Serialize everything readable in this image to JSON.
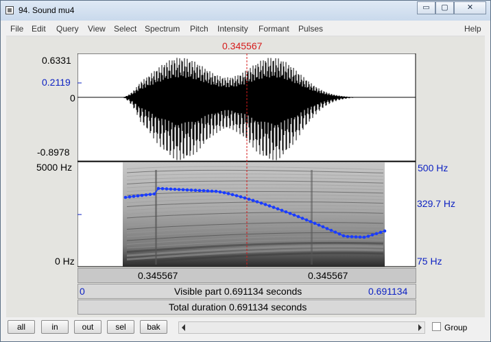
{
  "window": {
    "title": "94. Sound mu4",
    "buttons": {
      "minimize": "▭",
      "restore": "▢",
      "close": "✕"
    }
  },
  "menu": [
    "File",
    "Edit",
    "Query",
    "View",
    "Select",
    "Spectrum",
    "Pitch",
    "Intensity",
    "Formant",
    "Pulses",
    "Help"
  ],
  "cursor": {
    "time_label": "0.345567"
  },
  "waveform": {
    "max_label": "0.6331",
    "cursor_value_label": "0.2119",
    "zero_label": "0",
    "min_label": "-0.8978"
  },
  "spectrogram": {
    "top_label": "5000 Hz",
    "bottom_label": "0 Hz"
  },
  "pitch": {
    "top_label": "500 Hz",
    "cursor_label": "329.7 Hz",
    "bottom_label": "75 Hz"
  },
  "time_bar": {
    "left": "0.345567",
    "right": "0.345567"
  },
  "visible_bar": {
    "start": "0",
    "text": "Visible part 0.691134 seconds",
    "end": "0.691134"
  },
  "total_bar": {
    "text": "Total duration 0.691134 seconds"
  },
  "buttons": {
    "all": "all",
    "in": "in",
    "out": "out",
    "sel": "sel",
    "bak": "bak"
  },
  "group": {
    "label": "Group"
  },
  "colors": {
    "cursor": "#d61a1a",
    "pitch": "#1a3cff",
    "axis_blue": "#0a1fc2"
  }
}
